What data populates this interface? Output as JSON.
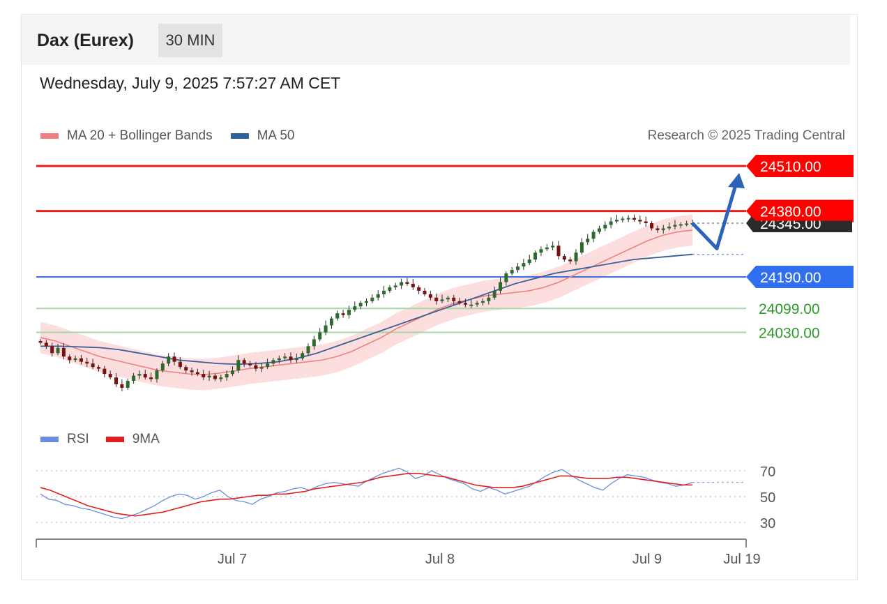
{
  "header": {
    "instrument": "Dax (Eurex)",
    "timeframe": "30 MIN"
  },
  "timestamp": "Wednesday, July 9, 2025 7:57:27 AM CET",
  "legend_main": {
    "items": [
      {
        "label": "MA 20 + Bollinger Bands",
        "color": "#f08080"
      },
      {
        "label": "MA 50",
        "color": "#2e5f9e"
      }
    ]
  },
  "copyright": "Research © 2025 Trading Central",
  "legend_rsi": {
    "items": [
      {
        "label": "RSI",
        "color": "#6b8de0"
      },
      {
        "label": "9MA",
        "color": "#e02020"
      }
    ]
  },
  "chart_data": {
    "type": "candlestick",
    "last_price_label": "24345.00",
    "levels": [
      {
        "value": 24510,
        "label": "24510.00",
        "kind": "resistance",
        "color": "#ff0000"
      },
      {
        "value": 24380,
        "label": "24380.00",
        "kind": "resistance",
        "color": "#ff0000"
      },
      {
        "value": 24190,
        "label": "24190.00",
        "kind": "pivot",
        "color": "#2f6ff0"
      },
      {
        "value": 24099,
        "label": "24099.00",
        "kind": "support",
        "color": "#2b9a2b"
      },
      {
        "value": 24030,
        "label": "24030.00",
        "kind": "support",
        "color": "#2b9a2b"
      }
    ],
    "x_ticks": [
      "Jul 7",
      "Jul 8",
      "Jul 9",
      "Jul 19"
    ],
    "closes": [
      24000,
      23990,
      23970,
      23985,
      23960,
      23950,
      23955,
      23945,
      23940,
      23930,
      23925,
      23910,
      23900,
      23880,
      23870,
      23890,
      23905,
      23910,
      23900,
      23895,
      23920,
      23940,
      23960,
      23945,
      23930,
      23920,
      23915,
      23910,
      23900,
      23905,
      23895,
      23900,
      23910,
      23920,
      23950,
      23940,
      23935,
      23925,
      23930,
      23940,
      23950,
      23955,
      23960,
      23950,
      23955,
      23970,
      23990,
      24010,
      24030,
      24050,
      24070,
      24085,
      24080,
      24095,
      24105,
      24115,
      24120,
      24130,
      24140,
      24150,
      24160,
      24165,
      24175,
      24170,
      24160,
      24150,
      24140,
      24130,
      24120,
      24125,
      24130,
      24120,
      24115,
      24110,
      24110,
      24115,
      24120,
      24130,
      24150,
      24175,
      24200,
      24210,
      24220,
      24230,
      24240,
      24260,
      24270,
      24275,
      24280,
      24250,
      24240,
      24235,
      24260,
      24290,
      24300,
      24320,
      24330,
      24340,
      24350,
      24355,
      24358,
      24360,
      24355,
      24350,
      24345,
      24330,
      24325,
      24330,
      24335,
      24340,
      24342,
      24344,
      24345
    ],
    "ma20": [
      24015,
      24005,
      23990,
      23975,
      23960,
      23950,
      23940,
      23930,
      23920,
      23915,
      23910,
      23908,
      23912,
      23918,
      23925,
      23930,
      23935,
      23940,
      23945,
      23950,
      23960,
      23975,
      23995,
      24015,
      24040,
      24060,
      24080,
      24100,
      24115,
      24125,
      24135,
      24140,
      24145,
      24150,
      24160,
      24175,
      24195,
      24215,
      24235,
      24255,
      24275,
      24295,
      24310,
      24320,
      24325
    ],
    "ma50": [
      23990,
      23990,
      23988,
      23986,
      23980,
      23970,
      23960,
      23950,
      23945,
      23940,
      23938,
      23940,
      23945,
      23955,
      23970,
      23990,
      24010,
      24030,
      24050,
      24070,
      24090,
      24110,
      24130,
      24150,
      24170,
      24185,
      24200,
      24210,
      24220,
      24230,
      24240,
      24245,
      24250,
      24255
    ],
    "bb_upper_offset": 45,
    "bb_lower_offset": 45,
    "forecast": {
      "from": 24345,
      "dip_to": 24300,
      "target": 24510
    },
    "rsi": {
      "levels": [
        70,
        50,
        30
      ],
      "rsi_values": [
        52,
        48,
        47,
        44,
        43,
        41,
        40,
        38,
        36,
        34,
        33,
        35,
        37,
        40,
        43,
        47,
        50,
        52,
        51,
        48,
        50,
        53,
        55,
        50,
        47,
        46,
        44,
        48,
        50,
        53,
        54,
        56,
        57,
        55,
        58,
        60,
        61,
        60,
        59,
        58,
        62,
        65,
        68,
        70,
        72,
        69,
        64,
        66,
        70,
        67,
        64,
        62,
        60,
        56,
        54,
        57,
        55,
        52,
        54,
        56,
        58,
        62,
        66,
        69,
        71,
        67,
        63,
        60,
        57,
        55,
        60,
        64,
        67,
        66,
        65,
        63,
        61,
        60,
        58,
        59,
        61
      ],
      "ma9_values": [
        57,
        55,
        52,
        49,
        46,
        43,
        41,
        39,
        37,
        36,
        35,
        36,
        37,
        38,
        40,
        42,
        44,
        46,
        47,
        48,
        48,
        49,
        50,
        51,
        51,
        52,
        52,
        53,
        54,
        56,
        57,
        58,
        59,
        60,
        61,
        63,
        65,
        66,
        67,
        68,
        68,
        67,
        66,
        65,
        63,
        61,
        59,
        58,
        57,
        57,
        57,
        58,
        60,
        62,
        64,
        66,
        66,
        65,
        64,
        64,
        64,
        65,
        65,
        64,
        63,
        62,
        61,
        60,
        59,
        59
      ]
    }
  }
}
